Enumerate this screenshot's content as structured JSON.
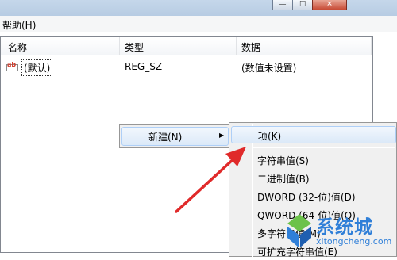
{
  "window": {
    "minimize_glyph": "—",
    "maximize_glyph": "☐",
    "close_glyph": "✕"
  },
  "menubar": {
    "help": "帮助(H)"
  },
  "list": {
    "columns": [
      "名称",
      "类型",
      "数据"
    ],
    "rows": [
      {
        "icon": "reg-string-icon",
        "icon_text": "ab",
        "name": "(默认)",
        "type": "REG_SZ",
        "data": "(数值未设置)"
      }
    ]
  },
  "context_menu": {
    "items": [
      {
        "label": "新建(N)",
        "has_submenu": true
      }
    ]
  },
  "submenu": {
    "items": [
      {
        "label": "项(K)",
        "highlighted": true
      },
      {
        "label": "字符串值(S)"
      },
      {
        "label": "二进制值(B)"
      },
      {
        "label": "DWORD (32-位)值(D)"
      },
      {
        "label": "QWORD (64-位)值(Q)"
      },
      {
        "label": "多字符串值(M)"
      },
      {
        "label": "可扩充字符串值(E)"
      }
    ]
  },
  "annotation": {
    "color": "#e02a2a",
    "shape": "red-arrow"
  },
  "watermark": {
    "text": "系统城",
    "url": "xitongcheng.com",
    "color": "#2f7fd8"
  }
}
